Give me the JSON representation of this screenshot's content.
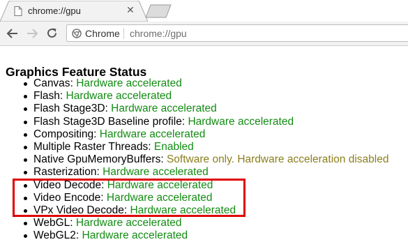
{
  "browser": {
    "tab": {
      "title": "chrome://gpu",
      "close_glyph": "✕"
    },
    "omnibox": {
      "site_label": "Chrome",
      "url": "chrome://gpu"
    }
  },
  "page": {
    "title": "Graphics Feature Status",
    "features": [
      {
        "name": "Canvas",
        "status": "Hardware accelerated",
        "status_color": "green"
      },
      {
        "name": "Flash",
        "status": "Hardware accelerated",
        "status_color": "green"
      },
      {
        "name": "Flash Stage3D",
        "status": "Hardware accelerated",
        "status_color": "green"
      },
      {
        "name": "Flash Stage3D Baseline profile",
        "status": "Hardware accelerated",
        "status_color": "green"
      },
      {
        "name": "Compositing",
        "status": "Hardware accelerated",
        "status_color": "green"
      },
      {
        "name": "Multiple Raster Threads",
        "status": "Enabled",
        "status_color": "green"
      },
      {
        "name": "Native GpuMemoryBuffers",
        "status": "Software only. Hardware acceleration disabled",
        "status_color": "yellow"
      },
      {
        "name": "Rasterization",
        "status": "Hardware accelerated",
        "status_color": "green"
      },
      {
        "name": "Video Decode",
        "status": "Hardware accelerated",
        "status_color": "green"
      },
      {
        "name": "Video Encode",
        "status": "Hardware accelerated",
        "status_color": "green"
      },
      {
        "name": "VPx Video Decode",
        "status": "Hardware accelerated",
        "status_color": "green"
      },
      {
        "name": "WebGL",
        "status": "Hardware accelerated",
        "status_color": "green"
      },
      {
        "name": "WebGL2",
        "status": "Hardware accelerated",
        "status_color": "green"
      }
    ]
  },
  "colors": {
    "status_green": "#138c13",
    "status_yellow": "#8c7f1e",
    "highlight_red": "#e00000"
  }
}
